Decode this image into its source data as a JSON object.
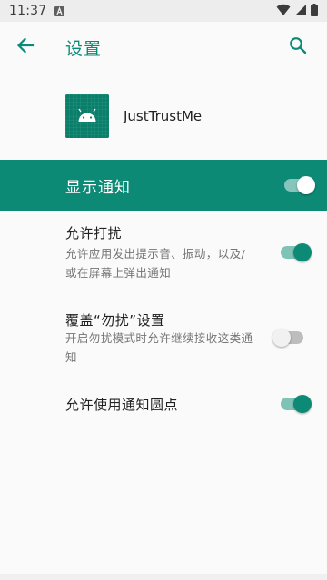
{
  "status_bar": {
    "time": "11:37",
    "notification_icon": "font-a-icon",
    "icons": [
      "wifi-icon",
      "cellular-signal-icon",
      "battery-icon"
    ]
  },
  "app_bar": {
    "title": "设置",
    "back_icon": "arrow-back-icon",
    "search_icon": "search-icon"
  },
  "app_header": {
    "app_name": "JustTrustMe",
    "icon": "android-robot-icon"
  },
  "master_switch": {
    "label": "显示通知",
    "enabled": true
  },
  "preferences": [
    {
      "title": "允许打扰",
      "summary": "允许应用发出提示音、振动，以及/或在屏幕上弹出通知",
      "enabled": true
    },
    {
      "title": "覆盖“勿扰”设置",
      "summary": "开启勿扰模式时允许继续接收这类通知",
      "enabled": false
    },
    {
      "title": "允许使用通知圆点",
      "summary": "",
      "enabled": true
    }
  ],
  "colors": {
    "accent": "#0d8a76",
    "accent_track": "#7fc2b6",
    "background": "#fafafa",
    "status_bar": "#ededed"
  }
}
